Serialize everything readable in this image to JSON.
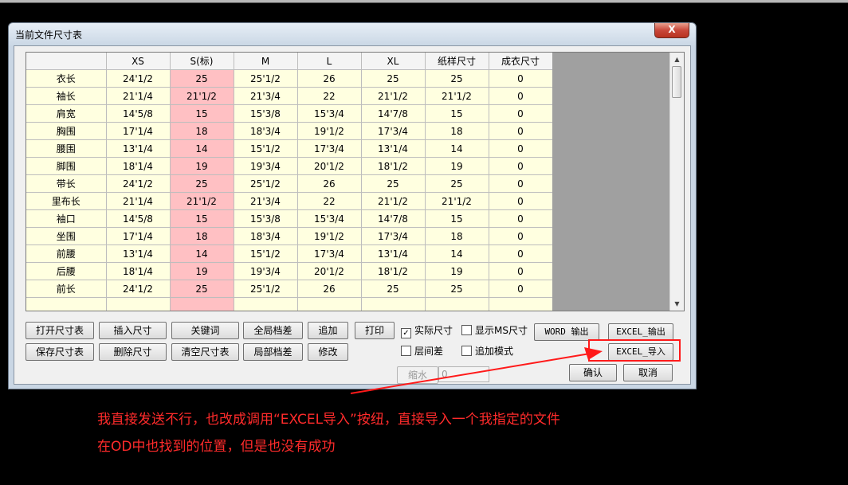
{
  "window": {
    "title": "当前文件尺寸表",
    "close_label": "X"
  },
  "table": {
    "columns": [
      "",
      "XS",
      "S(标)",
      "M",
      "L",
      "XL",
      "纸样尺寸",
      "成衣尺寸"
    ],
    "rows": [
      [
        "衣长",
        "24'1/2",
        "25",
        "25'1/2",
        "26",
        "25",
        "25",
        "0"
      ],
      [
        "袖长",
        "21'1/4",
        "21'1/2",
        "21'3/4",
        "22",
        "21'1/2",
        "21'1/2",
        "0"
      ],
      [
        "肩宽",
        "14'5/8",
        "15",
        "15'3/8",
        "15'3/4",
        "14'7/8",
        "15",
        "0"
      ],
      [
        "胸围",
        "17'1/4",
        "18",
        "18'3/4",
        "19'1/2",
        "17'3/4",
        "18",
        "0"
      ],
      [
        "腰围",
        "13'1/4",
        "14",
        "15'1/2",
        "17'3/4",
        "13'1/4",
        "14",
        "0"
      ],
      [
        "脚围",
        "18'1/4",
        "19",
        "19'3/4",
        "20'1/2",
        "18'1/2",
        "19",
        "0"
      ],
      [
        "带长",
        "24'1/2",
        "25",
        "25'1/2",
        "26",
        "25",
        "25",
        "0"
      ],
      [
        "里布长",
        "21'1/4",
        "21'1/2",
        "21'3/4",
        "22",
        "21'1/2",
        "21'1/2",
        "0"
      ],
      [
        "袖口",
        "14'5/8",
        "15",
        "15'3/8",
        "15'3/4",
        "14'7/8",
        "15",
        "0"
      ],
      [
        "坐围",
        "17'1/4",
        "18",
        "18'3/4",
        "19'1/2",
        "17'3/4",
        "18",
        "0"
      ],
      [
        "前腰",
        "13'1/4",
        "14",
        "15'1/2",
        "17'3/4",
        "13'1/4",
        "14",
        "0"
      ],
      [
        "后腰",
        "18'1/4",
        "19",
        "19'3/4",
        "20'1/2",
        "18'1/2",
        "19",
        "0"
      ],
      [
        "前长",
        "24'1/2",
        "25",
        "25'1/2",
        "26",
        "25",
        "25",
        "0"
      ]
    ],
    "highlight_column": "S(标)",
    "highlight_color": "#ffc0c3",
    "cell_color": "#ffffe0",
    "empty_area_color": "#a0a0a0"
  },
  "buttons": {
    "open_size_table": "打开尺寸表",
    "insert_size": "插入尺寸",
    "keyword": "关键词",
    "global_grade": "全局档差",
    "append": "追加",
    "print": "打印",
    "word_export": "WORD 输出",
    "excel_export": "EXCEL_输出",
    "save_size_table": "保存尺寸表",
    "delete_size": "删除尺寸",
    "clear_size_table": "清空尺寸表",
    "local_grade": "局部档差",
    "modify": "修改",
    "excel_import": "EXCEL_导入",
    "shrink": "缩水",
    "confirm": "确认",
    "cancel": "取消"
  },
  "checkboxes": {
    "actual_size": {
      "label": "实际尺寸",
      "checked": true
    },
    "show_ms_size": {
      "label": "显示MS尺寸",
      "checked": false
    },
    "layer_diff": {
      "label": "层间差",
      "checked": false
    },
    "append_mode": {
      "label": "追加模式",
      "checked": false
    }
  },
  "shrink_value": "0",
  "annotation": {
    "line1": "我直接发送不行，也改成调用“EXCEL导入”按纽，直接导入一个我指定的文件",
    "line2": "在OD中也找到的位置，但是也没有成功",
    "color": "#ff2b2b"
  }
}
